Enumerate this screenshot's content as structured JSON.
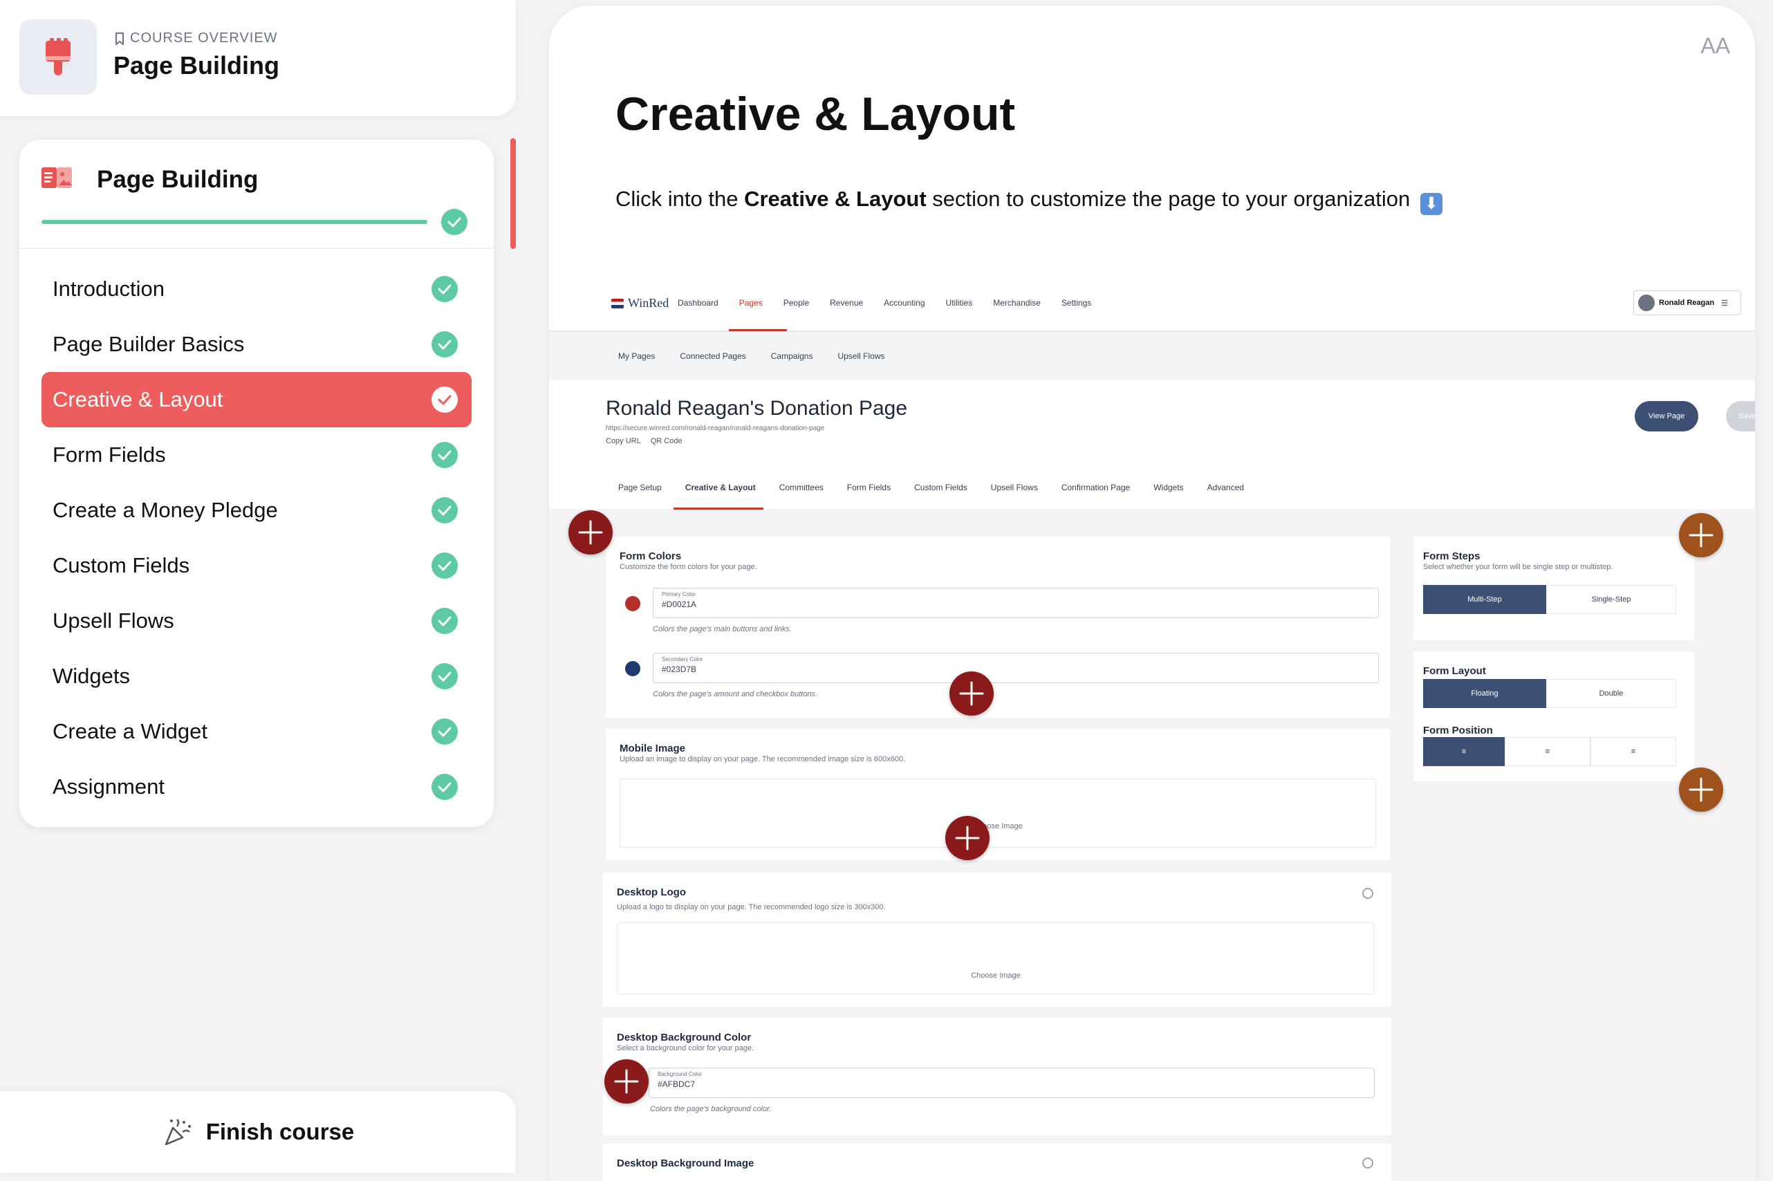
{
  "course": {
    "overview_label": "COURSE OVERVIEW",
    "title": "Page Building"
  },
  "lesson_panel": {
    "title": "Page Building",
    "progress_pct": 100,
    "items": [
      {
        "label": "Introduction",
        "completed": true,
        "active": false
      },
      {
        "label": "Page Builder Basics",
        "completed": true,
        "active": false
      },
      {
        "label": "Creative & Layout",
        "completed": true,
        "active": true
      },
      {
        "label": "Form Fields",
        "completed": true,
        "active": false
      },
      {
        "label": "Create a Money Pledge",
        "completed": true,
        "active": false
      },
      {
        "label": "Custom Fields",
        "completed": true,
        "active": false
      },
      {
        "label": "Upsell Flows",
        "completed": true,
        "active": false
      },
      {
        "label": "Widgets",
        "completed": true,
        "active": false
      },
      {
        "label": "Create a Widget",
        "completed": true,
        "active": false
      },
      {
        "label": "Assignment",
        "completed": true,
        "active": false
      }
    ]
  },
  "finish": {
    "label": "Finish course"
  },
  "main": {
    "font_toggle": "AA",
    "title": "Creative & Layout",
    "instruction_before": "Click into the ",
    "instruction_bold": "Creative & Layout",
    "instruction_after": " section to customize the page to your organization",
    "instruction_emoji": "⬇"
  },
  "winred": {
    "logo": "WinRed",
    "nav": [
      "Dashboard",
      "Pages",
      "People",
      "Revenue",
      "Accounting",
      "Utilities",
      "Merchandise",
      "Settings"
    ],
    "nav_active": "Pages",
    "user": "Ronald Reagan",
    "subnav": [
      "My Pages",
      "Connected Pages",
      "Campaigns",
      "Upsell Flows"
    ],
    "page_title": "Ronald Reagan's Donation Page",
    "page_url": "https://secure.winred.com/ronald-reagan/ronald-reagans-donation-page",
    "copy_url": "Copy URL",
    "qr_code": "QR Code",
    "view_page": "View Page",
    "save": "Save",
    "tabs": [
      "Page Setup",
      "Creative & Layout",
      "Committees",
      "Form Fields",
      "Custom Fields",
      "Upsell Flows",
      "Confirmation Page",
      "Widgets",
      "Advanced"
    ],
    "active_tab": "Creative & Layout",
    "form_colors": {
      "title": "Form Colors",
      "desc": "Customize the form colors for your page.",
      "primary_label": "Primary Color",
      "primary_value": "#D0021A",
      "primary_hint": "Colors the page's main buttons and links.",
      "secondary_label": "Secondary Color",
      "secondary_value": "#023D7B",
      "secondary_hint": "Colors the page's amount and checkbox buttons.",
      "primary_color": "#b5302a",
      "secondary_color": "#1f3a6e"
    },
    "mobile_image": {
      "title": "Mobile Image",
      "desc": "Upload an image to display on your page. The recommended image size is 600x600.",
      "choose": "Choose Image"
    },
    "desktop_logo": {
      "title": "Desktop Logo",
      "desc": "Upload a logo to display on your page. The recommended logo size is 300x300.",
      "choose": "Choose Image"
    },
    "desktop_bg_color": {
      "title": "Desktop Background Color",
      "desc": "Select a background color for your page.",
      "field_label": "Background Color",
      "value": "#AFBDC7",
      "hint": "Colors the page's background color."
    },
    "desktop_bg_image": {
      "title": "Desktop Background Image"
    },
    "form_steps": {
      "title": "Form Steps",
      "desc": "Select whether your form will be single step or multistep.",
      "options": [
        "Multi-Step",
        "Single-Step"
      ],
      "selected": "Multi-Step"
    },
    "form_layout": {
      "title": "Form Layout",
      "options": [
        "Floating",
        "Double"
      ],
      "selected": "Floating"
    },
    "form_position": {
      "title": "Form Position"
    }
  },
  "colors": {
    "accent": "#ed5d5d",
    "check": "#5cc9a7",
    "hotspot_red": "#8b1a1a",
    "hotspot_brown": "#a0521c",
    "navy_button": "#3d4f72"
  },
  "icons": {
    "course": "paint-brush-icon",
    "overview": "bookmark-icon",
    "lesson_card": "document-image-icon",
    "check": "check-circle-icon",
    "finish": "party-popper-icon",
    "hotspot": "plus-circle-icon"
  }
}
